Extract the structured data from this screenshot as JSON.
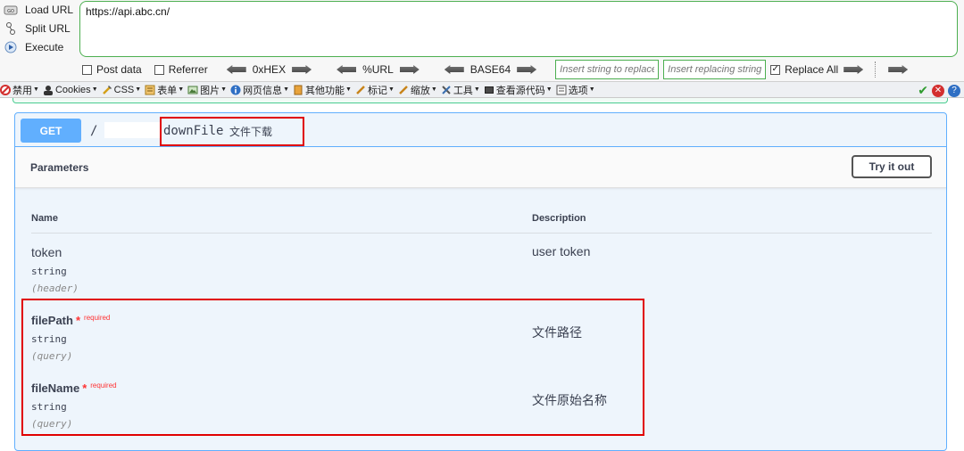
{
  "hackbar": {
    "actions": [
      {
        "label": "Load URL",
        "icon": "load-url-icon"
      },
      {
        "label": "Split URL",
        "icon": "split-url-icon"
      },
      {
        "label": "Execute",
        "icon": "execute-icon"
      }
    ],
    "url_value": "https://api.abc.cn/",
    "options": {
      "post_data": {
        "label": "Post data",
        "checked": false
      },
      "referrer": {
        "label": "Referrer",
        "checked": false
      },
      "hex_label": "0xHEX",
      "url_label": "%URL",
      "base64_label": "BASE64",
      "replace_from_placeholder": "Insert string to replace",
      "replace_to_placeholder": "Insert replacing string",
      "replace_all": {
        "label": "Replace All",
        "checked": true
      }
    }
  },
  "toolbar": {
    "items": [
      {
        "label": "禁用",
        "icon": "disable-icon"
      },
      {
        "label": "Cookies",
        "icon": "cookies-icon"
      },
      {
        "label": "CSS",
        "icon": "css-icon"
      },
      {
        "label": "表单",
        "icon": "form-icon"
      },
      {
        "label": "图片",
        "icon": "image-icon"
      },
      {
        "label": "网页信息",
        "icon": "info-icon"
      },
      {
        "label": "其他功能",
        "icon": "misc-icon"
      },
      {
        "label": "标记",
        "icon": "mark-icon"
      },
      {
        "label": "缩放",
        "icon": "zoom-icon"
      },
      {
        "label": "工具",
        "icon": "tools-icon"
      },
      {
        "label": "查看源代码",
        "icon": "source-icon"
      },
      {
        "label": "选项",
        "icon": "options-icon"
      }
    ]
  },
  "operation": {
    "method": "GET",
    "path_prefix": "/",
    "path": "downFile",
    "summary": "文件下载",
    "parameters_title": "Parameters",
    "try_button": "Try it out",
    "column_name": "Name",
    "column_description": "Description",
    "required_label": "required",
    "params": [
      {
        "name": "token",
        "type": "string",
        "in": "(header)",
        "description": "user token",
        "required": false
      },
      {
        "name": "filePath",
        "type": "string",
        "in": "(query)",
        "description": "文件路径",
        "required": true
      },
      {
        "name": "fileName",
        "type": "string",
        "in": "(query)",
        "description": "文件原始名称",
        "required": true
      }
    ]
  },
  "colors": {
    "accent_green": "#4caf50",
    "get_blue": "#61affe",
    "required_red": "#ff3333",
    "highlight_red": "#e00000"
  }
}
